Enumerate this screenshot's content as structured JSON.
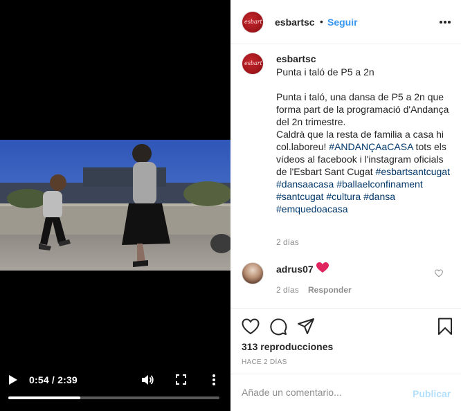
{
  "video": {
    "current_time": "0:54",
    "duration": "2:39",
    "time_display": "0:54 / 2:39",
    "progress": 0.34
  },
  "header": {
    "avatar_text": "esbart",
    "username": "esbartsc",
    "separator": "•",
    "follow_label": "Seguir"
  },
  "caption": {
    "username": "esbartsc",
    "segments": [
      {
        "text": "Punta i taló de P5 a 2n\n\nPunta i taló, una dansa de P5 a 2n que forma part de la programació d'Andança del 2n trimestre.\nCaldrà que la resta de familia a casa hi col.laboreu! ",
        "tag": false
      },
      {
        "text": "#ANDANÇAaCASA",
        "tag": true
      },
      {
        "text": " tots els vídeos al facebook i l'instagram oficials de l'Esbart Sant Cugat ",
        "tag": false
      },
      {
        "text": "#esbartsantcugat",
        "tag": true
      },
      {
        "text": " ",
        "tag": false
      },
      {
        "text": "#dansaacasa",
        "tag": true
      },
      {
        "text": " ",
        "tag": false
      },
      {
        "text": "#ballaelconfinament",
        "tag": true
      },
      {
        "text": " ",
        "tag": false
      },
      {
        "text": "#santcugat",
        "tag": true
      },
      {
        "text": " ",
        "tag": false
      },
      {
        "text": "#cultura",
        "tag": true
      },
      {
        "text": " ",
        "tag": false
      },
      {
        "text": "#dansa",
        "tag": true
      },
      {
        "text": " ",
        "tag": false
      },
      {
        "text": "#emquedoacasa",
        "tag": true
      }
    ],
    "time": "2 días"
  },
  "comment": {
    "username": "adrus07",
    "emoji": "heart",
    "time": "2 días",
    "reply_label": "Responder"
  },
  "stats": {
    "views": "313 reproducciones",
    "posted": "HACE 2 DÍAS"
  },
  "add_comment": {
    "placeholder": "Añade un comentario...",
    "publish_label": "Publicar"
  },
  "colors": {
    "link_blue": "#3897f0",
    "hashtag": "#00376b",
    "muted": "#8e8e8e",
    "heart_red": "#e0245e",
    "brand_red": "#a3171c"
  },
  "icons": [
    "play-icon",
    "volume-icon",
    "fullscreen-icon",
    "more-vertical-icon",
    "more-horizontal-icon",
    "heart-icon",
    "comment-icon",
    "share-icon",
    "bookmark-icon"
  ]
}
